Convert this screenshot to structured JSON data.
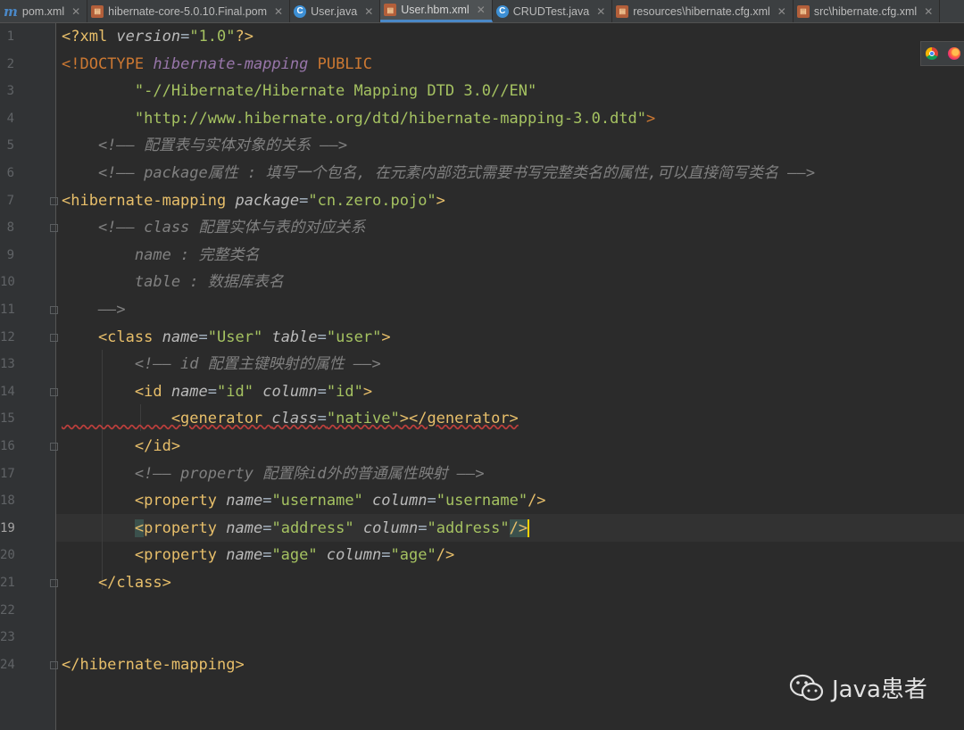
{
  "tabs": [
    {
      "label": "pom.xml",
      "icon": "maven-icon",
      "active": false
    },
    {
      "label": "hibernate-core-5.0.10.Final.pom",
      "icon": "xml-file-icon",
      "active": false
    },
    {
      "label": "User.java",
      "icon": "java-class-icon",
      "active": false
    },
    {
      "label": "User.hbm.xml",
      "icon": "xml-file-icon",
      "active": true
    },
    {
      "label": "CRUDTest.java",
      "icon": "java-class-icon",
      "active": false
    },
    {
      "label": "resources\\hibernate.cfg.xml",
      "icon": "xml-file-icon",
      "active": false
    },
    {
      "label": "src\\hibernate.cfg.xml",
      "icon": "xml-file-icon",
      "active": false
    }
  ],
  "line_numbers": [
    "1",
    "2",
    "3",
    "4",
    "5",
    "6",
    "7",
    "8",
    "9",
    "10",
    "11",
    "12",
    "13",
    "14",
    "15",
    "16",
    "17",
    "18",
    "19",
    "20",
    "21",
    "22",
    "23",
    "24"
  ],
  "code": {
    "l1": {
      "p1": "<?xml ",
      "a1": "version",
      "p2": "=",
      "s1": "\"1.0\"",
      "p3": "?>"
    },
    "l2": {
      "p1": "<!DOCTYPE ",
      "d1": "hibernate-mapping",
      "k1": " PUBLIC"
    },
    "l3": {
      "s1": "        \"-//Hibernate/Hibernate Mapping DTD 3.0//EN\""
    },
    "l4": {
      "s1": "        \"http://www.hibernate.org/dtd/hibernate-mapping-3.0.dtd\"",
      "p1": ">"
    },
    "l5": {
      "c1": "    <!—— 配置表与实体对象的关系 ——>"
    },
    "l6": {
      "c1": "    <!—— package属性 : 填写一个包名, 在元素内部范式需要书写完整类名的属性,可以直接简写类名 ——>"
    },
    "l7": {
      "t1": "<hibernate-mapping ",
      "a1": "package",
      "p1": "=",
      "s1": "\"cn.zero.pojo\"",
      "t2": ">"
    },
    "l8": {
      "c1": "    <!—— class 配置实体与表的对应关系"
    },
    "l9": {
      "c1": "        name : 完整类名"
    },
    "l10": {
      "c1": "        table : 数据库表名"
    },
    "l11": {
      "c1": "    ——>"
    },
    "l12": {
      "t1": "    <class ",
      "a1": "name",
      "p1": "=",
      "s1": "\"User\"",
      "a2": " table",
      "p2": "=",
      "s2": "\"user\"",
      "t2": ">"
    },
    "l13": {
      "c1": "        <!—— id 配置主键映射的属性 ——>"
    },
    "l14": {
      "t1": "        <id ",
      "a1": "name",
      "p1": "=",
      "s1": "\"id\"",
      "a2": " column",
      "p2": "=",
      "s2": "\"id\"",
      "t2": ">"
    },
    "l15": {
      "t1": "            <generator ",
      "a1": "class",
      "p1": "=",
      "s1": "\"native\"",
      "t2": "></generator>"
    },
    "l16": {
      "t1": "        </id>"
    },
    "l17": {
      "c1": "        <!—— property 配置除id外的普通属性映射 ——>"
    },
    "l18": {
      "t1": "        <property ",
      "a1": "name",
      "p1": "=",
      "s1": "\"username\"",
      "a2": " column",
      "p2": "=",
      "s2": "\"username\"",
      "t2": "/>"
    },
    "l19": {
      "t0": "        ",
      "t1": "<",
      "t1b": "property ",
      "a1": "name",
      "p1": "=",
      "s1": "\"address\"",
      "a2": " column",
      "p2": "=",
      "s2": "\"address\"",
      "t2": "/>"
    },
    "l20": {
      "t1": "        <property ",
      "a1": "name",
      "p1": "=",
      "s1": "\"age\"",
      "a2": " column",
      "p2": "=",
      "s2": "\"age\"",
      "t2": "/>"
    },
    "l21": {
      "t1": "    </class>"
    },
    "l24": {
      "t1": "</hibernate-mapping>"
    }
  },
  "browser_icons": [
    "chrome-icon",
    "firefox-icon"
  ],
  "watermark": {
    "text": "Java患者"
  },
  "colors": {
    "tag": "#e8bf6a",
    "string": "#a5c261",
    "comment": "#808080",
    "keyword": "#cc7832",
    "caret": "#ffd200"
  }
}
